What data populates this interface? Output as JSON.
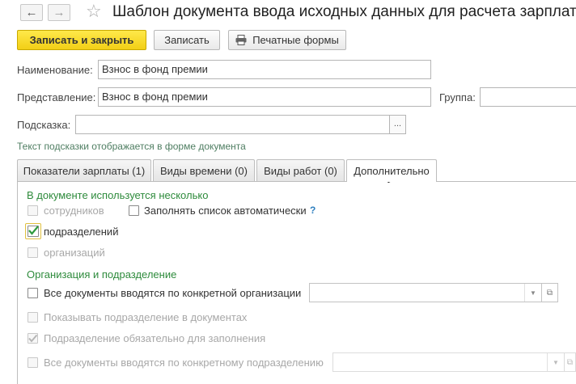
{
  "window": {
    "title": "Шаблон документа ввода исходных данных для расчета зарплаты"
  },
  "toolbar": {
    "back_icon": "←",
    "forward_icon": "→",
    "star_icon": "☆",
    "save_close_label": "Записать и закрыть",
    "save_label": "Записать",
    "print_label": "Печатные формы"
  },
  "form": {
    "name_label": "Наименование:",
    "name_value": "Взнос в фонд премии",
    "repr_label": "Представление:",
    "repr_value": "Взнос в фонд премии",
    "group_label": "Группа:",
    "group_value": "",
    "hint_label": "Подсказка:",
    "hint_value": "",
    "hint_btn": "...",
    "hint_note": "Текст подсказки отображается в форме документа"
  },
  "tabs": [
    {
      "label": "Показатели зарплаты (1)"
    },
    {
      "label": "Виды времени (0)"
    },
    {
      "label": "Виды работ (0)"
    },
    {
      "label": "Дополнительно"
    }
  ],
  "panel": {
    "section1": "В документе используется несколько",
    "employees": "сотрудников",
    "autofill": "Заполнять список автоматически",
    "help": "?",
    "departments": "подразделений",
    "organizations": "организаций",
    "section2": "Организация и подразделение",
    "all_by_org": "Все документы вводятся по конкретной организации",
    "show_dept": "Показывать подразделение в документах",
    "dept_required": "Подразделение обязательно для заполнения",
    "all_by_dept": "Все документы вводятся по конкретному подразделению"
  },
  "checks": {
    "employees": false,
    "autofill": false,
    "departments": true,
    "organizations": false,
    "all_by_org": false,
    "show_dept": false,
    "dept_required": true,
    "all_by_dept": false
  },
  "colors": {
    "accent_yellow": "#f5d41c",
    "section_green": "#2e8b3c",
    "check_green": "#2e9a3e"
  }
}
